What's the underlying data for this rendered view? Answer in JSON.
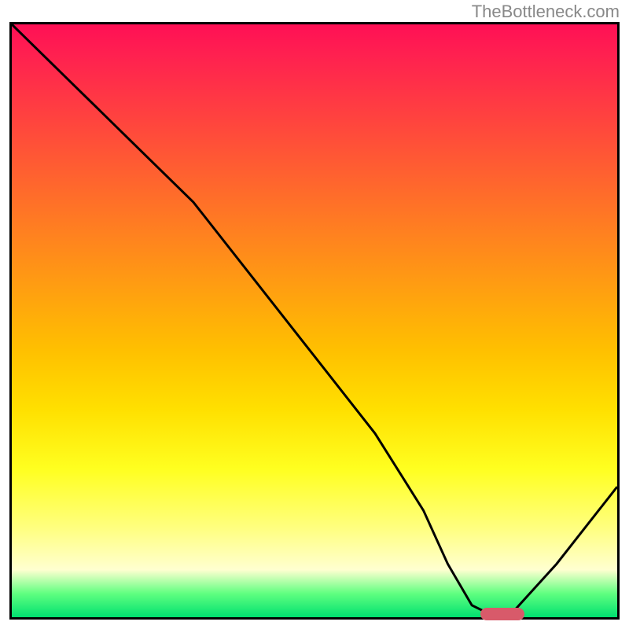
{
  "watermark": "TheBottleneck.com",
  "chart_data": {
    "type": "line",
    "title": "",
    "xlabel": "",
    "ylabel": "",
    "xlim": [
      0,
      100
    ],
    "ylim": [
      0,
      100
    ],
    "series": [
      {
        "name": "curve",
        "x": [
          0,
          10,
          22,
          30,
          40,
          50,
          60,
          68,
          72,
          76,
          80,
          82,
          90,
          100
        ],
        "values": [
          100,
          90,
          78,
          70,
          57,
          44,
          31,
          18,
          9,
          2,
          0,
          0,
          9,
          22
        ]
      }
    ],
    "marker": {
      "x": 81,
      "y": 0.5
    },
    "gradient_stops": [
      {
        "pos": 0,
        "color": "#ff1055"
      },
      {
        "pos": 15,
        "color": "#ff4040"
      },
      {
        "pos": 35,
        "color": "#ff8020"
      },
      {
        "pos": 55,
        "color": "#ffc000"
      },
      {
        "pos": 75,
        "color": "#ffff20"
      },
      {
        "pos": 92,
        "color": "#ffffd0"
      },
      {
        "pos": 100,
        "color": "#00e070"
      }
    ]
  }
}
